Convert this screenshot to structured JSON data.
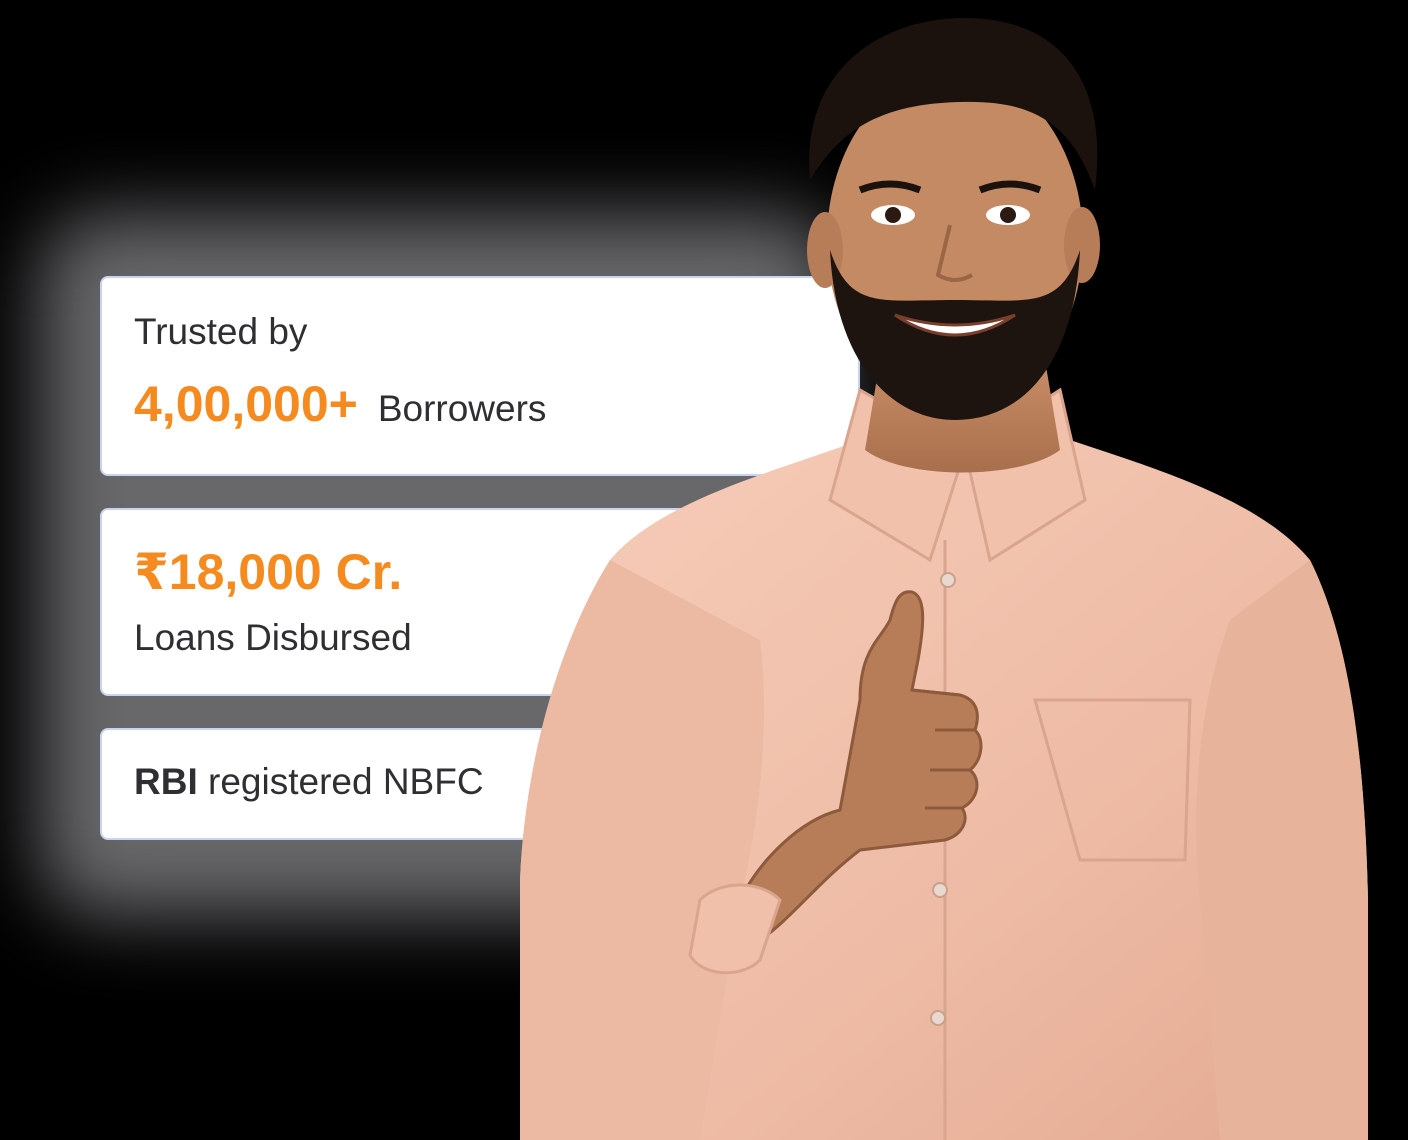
{
  "stats": {
    "trusted_prefix": "Trusted by",
    "borrowers_count": "4,00,000+",
    "borrowers_label": "Borrowers",
    "disbursed_amount": "₹18,000 Cr.",
    "disbursed_label": "Loans Disbursed",
    "rbi_strong": "RBI",
    "rbi_rest": " registered NBFC"
  },
  "colors": {
    "accent": "#f58a1f",
    "text": "#2f2f33",
    "card_border": "#c9d3ee",
    "shirt": "#f2c4b0"
  },
  "image": {
    "subject": "smiling-man-thumbs-up",
    "icon": "thumbs-up-icon"
  }
}
